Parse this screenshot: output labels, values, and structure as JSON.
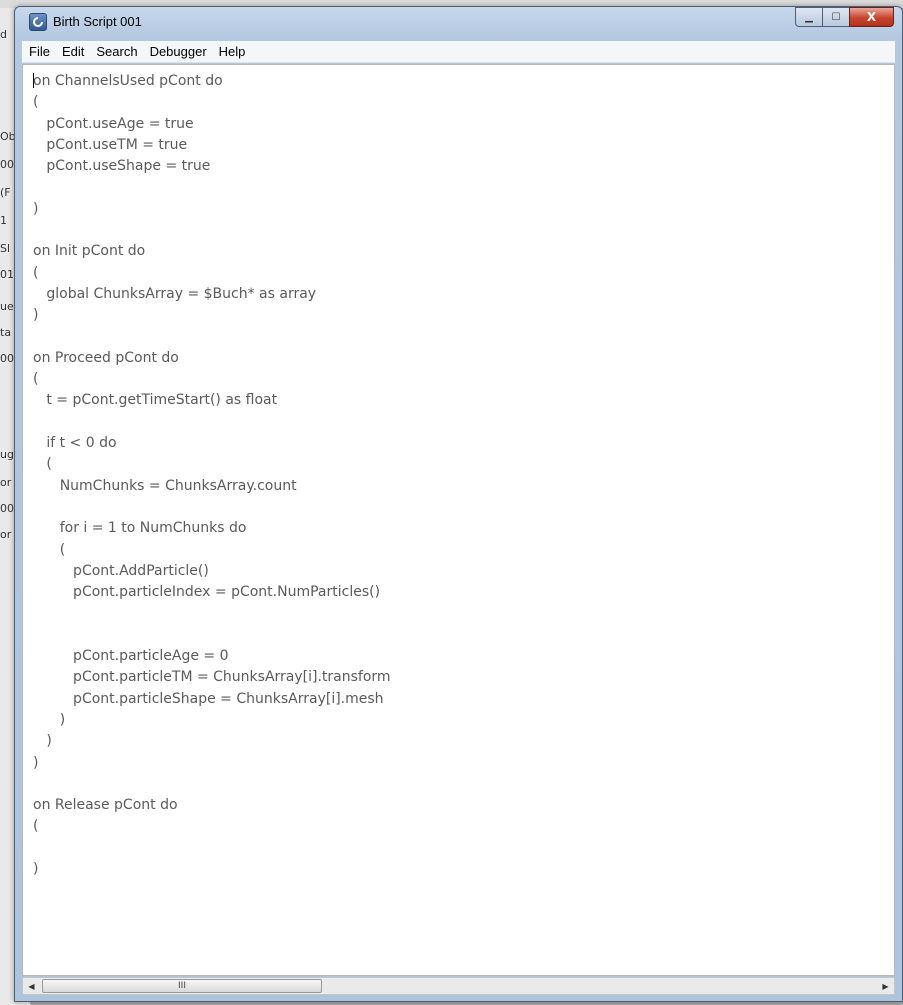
{
  "window": {
    "title": "Birth Script 001",
    "minimize_glyph": "▁",
    "maximize_glyph": "☐",
    "close_glyph": "X"
  },
  "menu": {
    "items": [
      "File",
      "Edit",
      "Search",
      "Debugger",
      "Help"
    ]
  },
  "editor": {
    "lines": [
      "on ChannelsUsed pCont do",
      "(",
      "   pCont.useAge = true",
      "   pCont.useTM = true",
      "   pCont.useShape = true",
      "",
      ")",
      "",
      "on Init pCont do",
      "(",
      "   global ChunksArray = $Buch* as array",
      ")",
      "",
      "on Proceed pCont do",
      "(",
      "   t = pCont.getTimeStart() as float",
      "",
      "   if t < 0 do",
      "   (",
      "      NumChunks = ChunksArray.count",
      "",
      "      for i = 1 to NumChunks do",
      "      (",
      "         pCont.AddParticle()",
      "         pCont.particleIndex = pCont.NumParticles()",
      "",
      "",
      "         pCont.particleAge = 0",
      "         pCont.particleTM = ChunksArray[i].transform",
      "         pCont.particleShape = ChunksArray[i].mesh",
      "      )",
      "   )",
      ")",
      "",
      "on Release pCont do",
      "(",
      "",
      ")"
    ]
  },
  "scrollbar": {
    "left_arrow": "◀",
    "right_arrow": "▶",
    "thumb_grip": "III"
  },
  "background": {
    "fragments": [
      "d",
      "Ob",
      "00",
      "(F",
      "1",
      "Sl",
      "01",
      "ue",
      "ta",
      "00",
      "ug",
      "or",
      "00",
      "or"
    ]
  }
}
